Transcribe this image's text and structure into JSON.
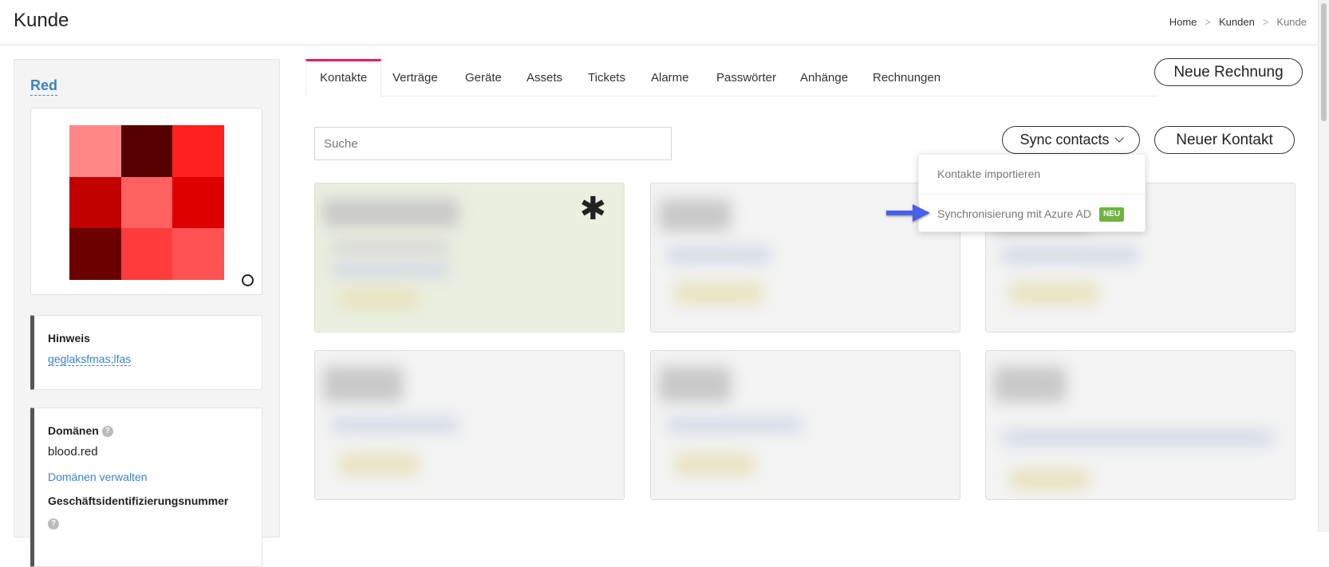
{
  "header": {
    "title": "Kunde",
    "breadcrumb": [
      "Home",
      "Kunden",
      "Kunde"
    ],
    "breadcrumb_sep": ">"
  },
  "sidebar": {
    "customer_name": "Red",
    "avatar_colors": [
      "#ff8787",
      "#540000",
      "#ff2020",
      "#c20000",
      "#ff6060",
      "#de0000",
      "#6b0000",
      "#ff3b3b",
      "#ff5252"
    ],
    "note": {
      "label": "Hinweis",
      "value": "geglaksfmas;lfas"
    },
    "domains": {
      "label": "Domänen",
      "help": "?",
      "value": "blood.red",
      "manage_link": "Domänen verwalten",
      "business_id_label": "Geschäftsidentifizierungsnummer",
      "business_id_help": "?"
    }
  },
  "tabs": [
    {
      "label": "Kontakte",
      "active": true
    },
    {
      "label": "Verträge",
      "active": false
    },
    {
      "label": "Geräte",
      "active": false
    },
    {
      "label": "Assets",
      "active": false
    },
    {
      "label": "Tickets",
      "active": false
    },
    {
      "label": "Alarme",
      "active": false
    },
    {
      "label": "Passwörter",
      "active": false
    },
    {
      "label": "Anhänge",
      "active": false
    },
    {
      "label": "Rechnungen",
      "active": false
    }
  ],
  "actions": {
    "new_invoice": "Neue Rechnung",
    "new_contact": "Neuer Kontakt",
    "sync_contacts": "Sync contacts"
  },
  "search": {
    "placeholder": "Suche",
    "value": ""
  },
  "sync_dropdown": {
    "items": [
      {
        "label": "Kontakte importieren"
      },
      {
        "label": "Synchronisierung mit Azure AD",
        "badge": "NEU"
      }
    ]
  },
  "contacts": {
    "favorite_marker": "✱"
  },
  "colors": {
    "accent_link": "#3b82c4",
    "active_tab": "#e91e63",
    "badge_new": "#6cb33f",
    "annotation_arrow": "#4a5fe8"
  }
}
